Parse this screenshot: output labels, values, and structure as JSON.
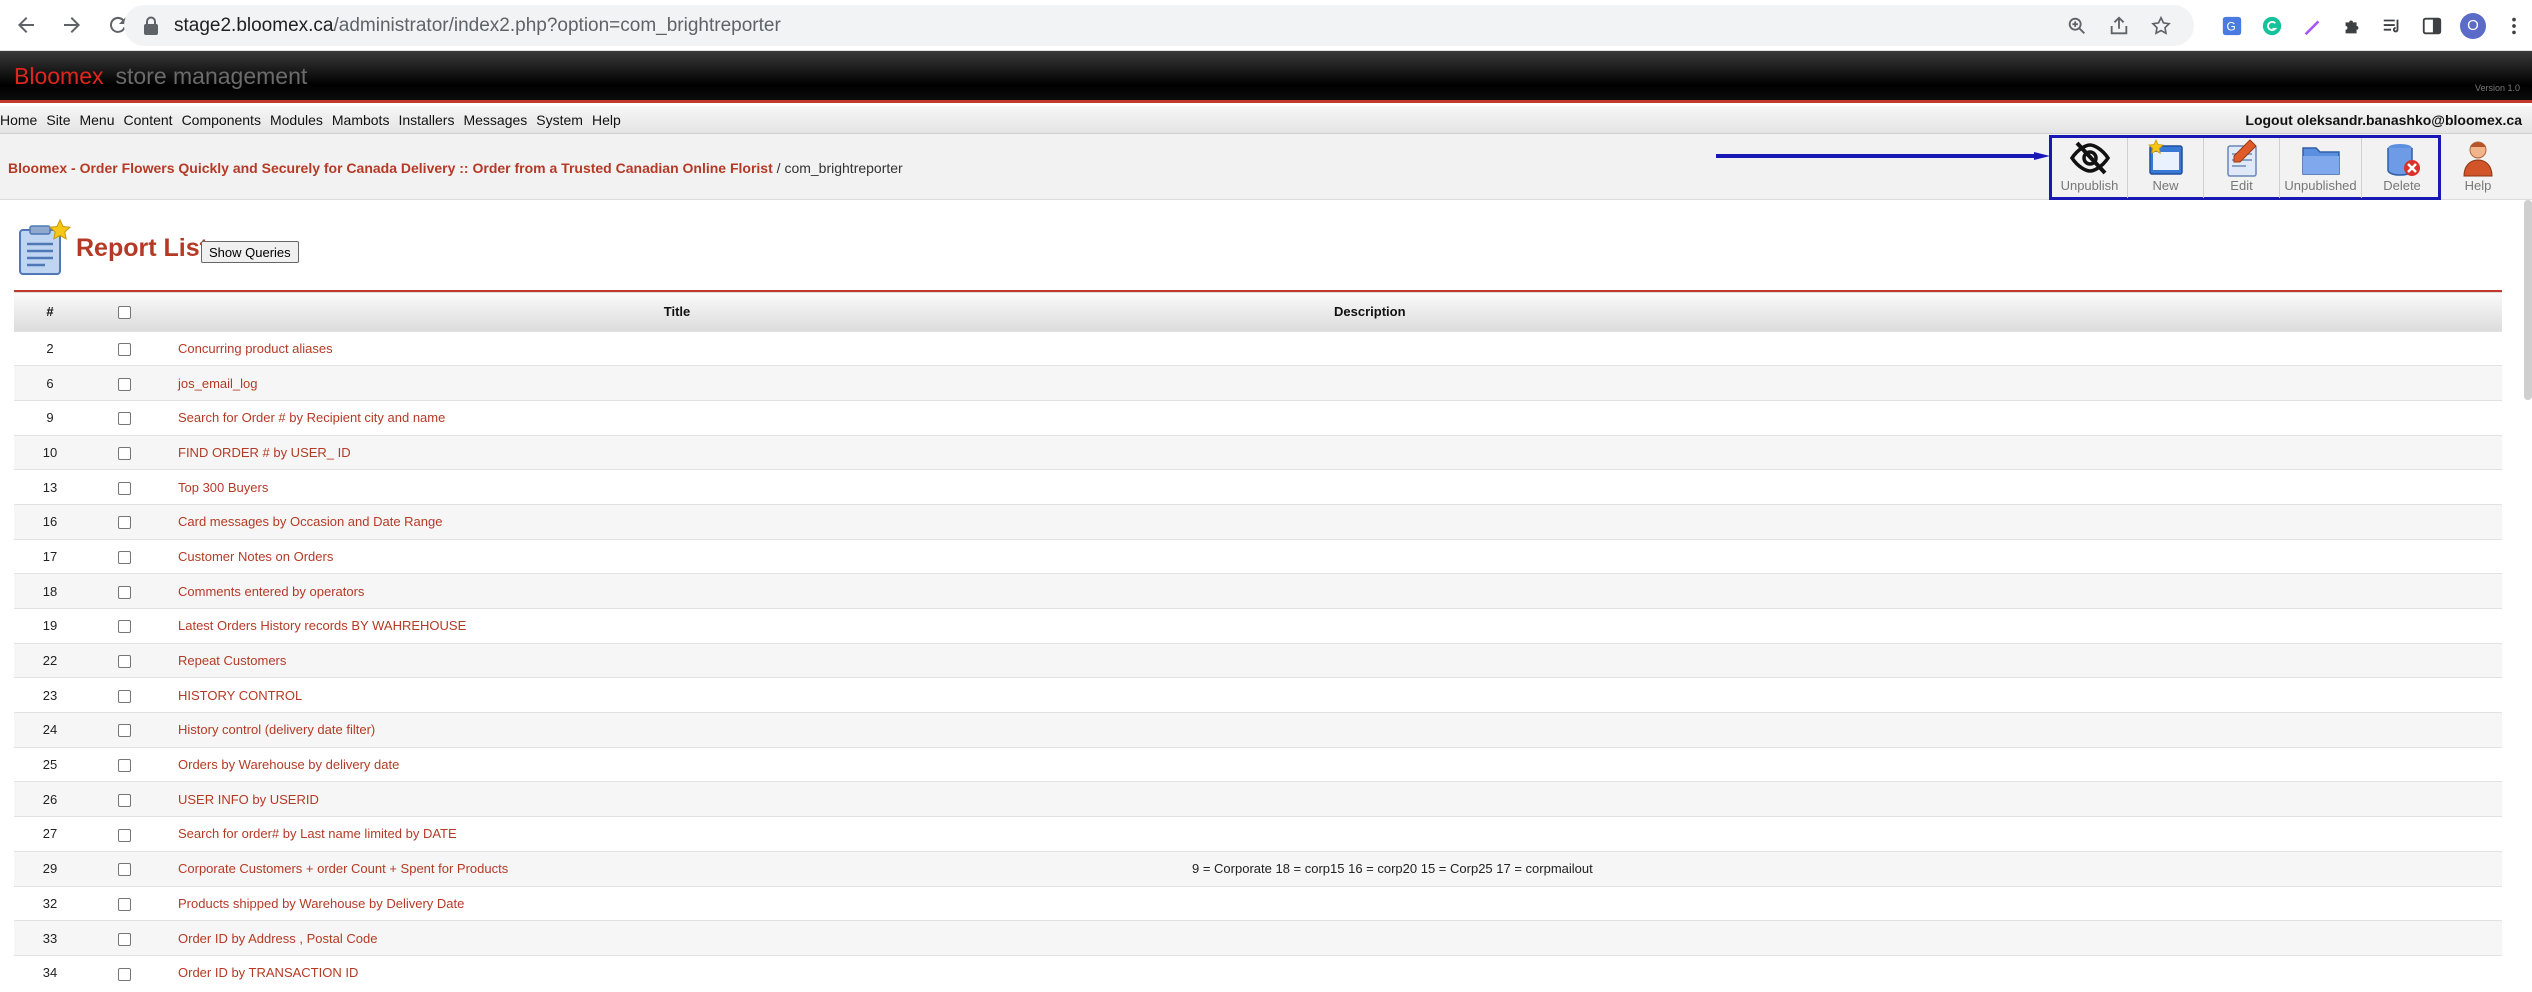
{
  "browser": {
    "url_host": "stage2.bloomex.ca",
    "url_path": "/administrator/index2.php?option=com_brightreporter",
    "profile_initial": "O"
  },
  "header": {
    "brand_name": "Bloomex",
    "brand_suffix": "store management",
    "version": "Version 1.0"
  },
  "menu": {
    "items": [
      "Home",
      "Site",
      "Menu",
      "Content",
      "Components",
      "Modules",
      "Mambots",
      "Installers",
      "Messages",
      "System",
      "Help"
    ],
    "logout_text": "Logout oleksandr.banashko@bloomex.ca"
  },
  "pathway": {
    "site_title": "Bloomex - Order Flowers Quickly and Securely for Canada Delivery :: Order from a Trusted Canadian Online Florist",
    "separator": " / ",
    "component": "com_brightreporter"
  },
  "toolbar": {
    "unpublish": "Unpublish",
    "new": "New",
    "edit": "Edit",
    "unpublished": "Unpublished",
    "delete": "Delete",
    "help": "Help"
  },
  "page": {
    "title": "Report List",
    "show_queries_label": "Show Queries"
  },
  "table": {
    "columns": {
      "num": "#",
      "title": "Title",
      "description": "Description"
    },
    "rows": [
      {
        "id": "2",
        "title": "Concurring product aliases",
        "description": ""
      },
      {
        "id": "6",
        "title": "jos_email_log",
        "description": ""
      },
      {
        "id": "9",
        "title": "Search for Order # by Recipient city and name",
        "description": ""
      },
      {
        "id": "10",
        "title": "FIND ORDER # by USER_ ID",
        "description": ""
      },
      {
        "id": "13",
        "title": "Top 300 Buyers",
        "description": ""
      },
      {
        "id": "16",
        "title": "Card messages by Occasion and Date Range",
        "description": ""
      },
      {
        "id": "17",
        "title": "Customer Notes on Orders",
        "description": ""
      },
      {
        "id": "18",
        "title": "Comments entered by operators",
        "description": ""
      },
      {
        "id": "19",
        "title": "Latest Orders History records BY WAHREHOUSE",
        "description": ""
      },
      {
        "id": "22",
        "title": "Repeat Customers",
        "description": ""
      },
      {
        "id": "23",
        "title": "HISTORY CONTROL",
        "description": ""
      },
      {
        "id": "24",
        "title": "History control (delivery date filter)",
        "description": ""
      },
      {
        "id": "25",
        "title": "Orders by Warehouse by delivery date",
        "description": ""
      },
      {
        "id": "26",
        "title": "USER INFO by USERID",
        "description": ""
      },
      {
        "id": "27",
        "title": "Search for order# by Last name limited by DATE",
        "description": ""
      },
      {
        "id": "29",
        "title": "Corporate Customers + order Count + Spent for Products",
        "description": "9 = Corporate 18 = corp15 16 = corp20 15 = Corp25 17 = corpmailout"
      },
      {
        "id": "32",
        "title": "Products shipped by Warehouse by Delivery Date",
        "description": ""
      },
      {
        "id": "33",
        "title": "Order ID by Address , Postal Code",
        "description": ""
      },
      {
        "id": "34",
        "title": "Order ID by TRANSACTION ID",
        "description": ""
      }
    ]
  }
}
